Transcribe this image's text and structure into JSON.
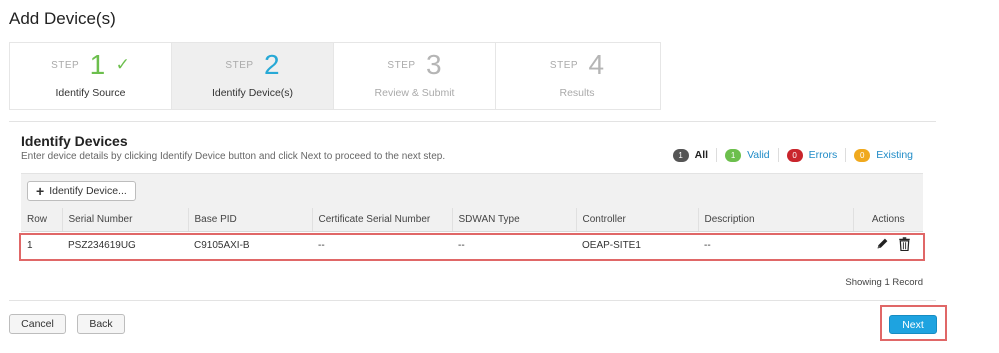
{
  "page_title": "Add Device(s)",
  "stepper": {
    "step_word": "STEP",
    "steps": [
      {
        "number": "1",
        "label": "Identify Source",
        "state": "done"
      },
      {
        "number": "2",
        "label": "Identify Device(s)",
        "state": "active"
      },
      {
        "number": "3",
        "label": "Review & Submit",
        "state": "pending"
      },
      {
        "number": "4",
        "label": "Results",
        "state": "pending"
      }
    ]
  },
  "section": {
    "title": "Identify Devices",
    "description": "Enter device details by clicking Identify Device button and click Next to proceed to the next step."
  },
  "filters": [
    {
      "count": "1",
      "label": "All",
      "color": "#555555",
      "selected": true
    },
    {
      "count": "1",
      "label": "Valid",
      "color": "#6cbf4d",
      "selected": false
    },
    {
      "count": "0",
      "label": "Errors",
      "color": "#c9252c",
      "selected": false
    },
    {
      "count": "0",
      "label": "Existing",
      "color": "#f0a91e",
      "selected": false
    }
  ],
  "toolbar": {
    "identify_label": "Identify Device..."
  },
  "table": {
    "columns": [
      "Row",
      "Serial Number",
      "Base PID",
      "Certificate Serial Number",
      "SDWAN Type",
      "Controller",
      "Description",
      "Actions"
    ],
    "rows": [
      {
        "row": "1",
        "serial": "PSZ234619UG",
        "pid": "C9105AXI-B",
        "cert": "--",
        "sdwan": "--",
        "controller": "OEAP-SITE1",
        "description": "--"
      }
    ]
  },
  "record_count": "Showing 1 Record",
  "footer": {
    "cancel_label": "Cancel",
    "back_label": "Back",
    "next_label": "Next"
  },
  "icons": {
    "edit": "pencil-icon",
    "delete": "trash-icon",
    "add": "plus-icon",
    "done": "check-icon"
  },
  "colors": {
    "accent": "#1ea3e0",
    "highlight": "#e06767"
  }
}
